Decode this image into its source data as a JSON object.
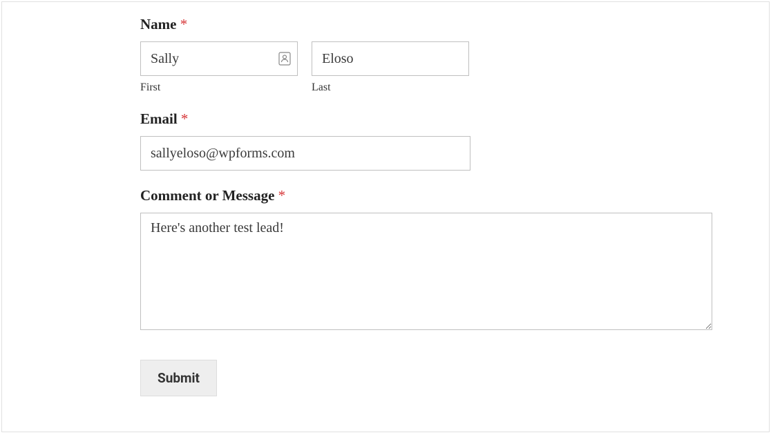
{
  "form": {
    "name": {
      "label": "Name",
      "required": "*",
      "first": {
        "value": "Sally",
        "sublabel": "First"
      },
      "last": {
        "value": "Eloso",
        "sublabel": "Last"
      }
    },
    "email": {
      "label": "Email",
      "required": "*",
      "value": "sallyeloso@wpforms.com"
    },
    "message": {
      "label": "Comment or Message",
      "required": "*",
      "value": "Here's another test lead!"
    },
    "submit": {
      "label": "Submit"
    }
  }
}
